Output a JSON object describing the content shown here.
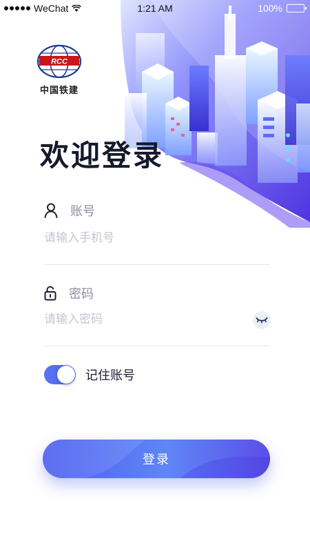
{
  "status_bar": {
    "carrier": "WeChat",
    "time": "1:21 AM",
    "battery": "100%",
    "battery_level": 1.0
  },
  "logo": {
    "emblem_text": "RCC",
    "company_name": "中国铁建"
  },
  "page_title": "欢迎登录",
  "account_field": {
    "label": "账号",
    "placeholder": "请输入手机号",
    "value": "",
    "icon": "user-icon"
  },
  "password_field": {
    "label": "密码",
    "placeholder": "请输入密码",
    "value": "",
    "icon": "lock-icon",
    "toggle_icon": "eye-closed-icon"
  },
  "remember_account": {
    "label": "记住账号",
    "enabled": true
  },
  "login_button": {
    "label": "登录"
  },
  "colors": {
    "accent": "#5468f0",
    "title_text": "#16192b",
    "placeholder": "#c2c6d3",
    "logo_red": "#c8161d",
    "logo_blue": "#1f3c8f"
  }
}
